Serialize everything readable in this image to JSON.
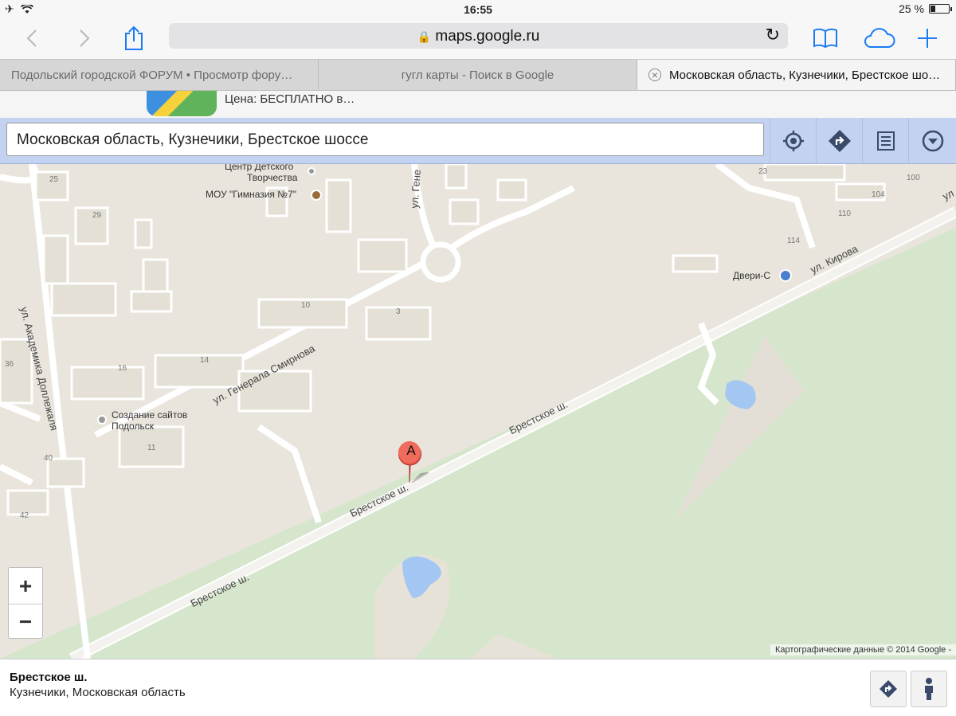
{
  "status": {
    "time": "16:55",
    "battery": "25 %",
    "battery_level": 0.25
  },
  "browser": {
    "url": "maps.google.ru",
    "tabs": [
      {
        "label": "Подольский городской ФОРУМ • Просмотр фору…",
        "active": false
      },
      {
        "label": "гугл карты - Поиск в Google",
        "active": false
      },
      {
        "label": "Московская область, Кузнечики, Брестское шо…",
        "active": true
      }
    ]
  },
  "banner": {
    "price": "Цена: БЕСПЛАТНО в…",
    "faded_title": "Google Maps"
  },
  "search": {
    "value": "Московская область, Кузнечики, Брестское шоссе"
  },
  "map": {
    "marker_label": "A",
    "pois": {
      "center_detskogo": "Центр Детского",
      "tvorchestva": "Творчества",
      "gymnasium": "МОУ \"Гимназия №7\"",
      "dveri": "Двери-С",
      "sozdanie": "Создание сайтов",
      "podolsk": "Подольск"
    },
    "streets": {
      "brestskoe_1": "Брестское ш.",
      "brestskoe_2": "Брестское ш.",
      "brestskoe_3": "Брестское ш.",
      "kirova": "ул. Кирова",
      "smirnova": "ул. Генерала Смирнова",
      "dolezhalya": "ул. Академика Доллежаля",
      "gene": "ул. Гене",
      "ul_edge": "ул"
    },
    "house_numbers": [
      "25",
      "29",
      "23",
      "100",
      "104",
      "110",
      "114",
      "10",
      "3",
      "14",
      "16",
      "36",
      "11",
      "40",
      "42"
    ],
    "copyright": "Картографические данные © 2014 Google -"
  },
  "zoom": {
    "in": "+",
    "out": "−"
  },
  "info": {
    "title": "Брестское ш.",
    "subtitle": "Кузнечики, Московская область"
  }
}
